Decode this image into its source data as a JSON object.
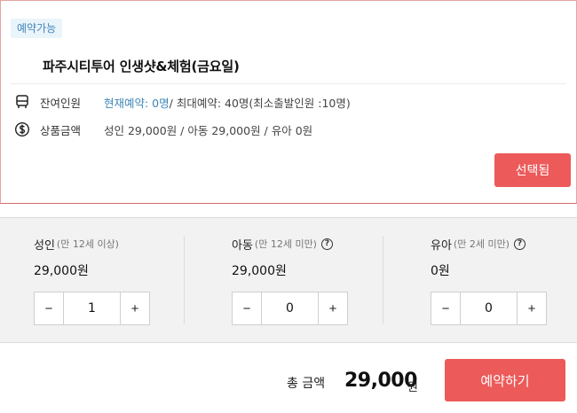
{
  "card": {
    "badge": "예약가능",
    "title": "파주시티투어 인생샷&체험(금요일)",
    "remaining": {
      "icon": "bus-icon",
      "label": "잔여인원",
      "current": "현재예약: 0명",
      "rest": "/ 최대예약: 40명(최소출발인원 :10명)"
    },
    "price": {
      "icon": "dollar-circle-icon",
      "label": "상품금액",
      "value": "성인 29,000원 / 아동 29,000원 / 유아 0원"
    },
    "selected_button": "선택됨"
  },
  "quantities": [
    {
      "name": "성인",
      "age": "(만 12세 이상)",
      "help": false,
      "price": "29,000원",
      "qty": "1"
    },
    {
      "name": "아동",
      "age": "(만 12세 미만)",
      "help": true,
      "price": "29,000원",
      "qty": "0"
    },
    {
      "name": "유아",
      "age": "(만 2세 미만)",
      "help": true,
      "price": "0원",
      "qty": "0"
    }
  ],
  "stepper": {
    "minus": "−",
    "plus": "+"
  },
  "help_glyph": "?",
  "footer": {
    "total_label": "총 금액",
    "total_value": "29,000",
    "total_unit": "원",
    "book_button": "예약하기"
  },
  "colors": {
    "accent": "#ec5a5a",
    "link": "#3f86b8"
  }
}
